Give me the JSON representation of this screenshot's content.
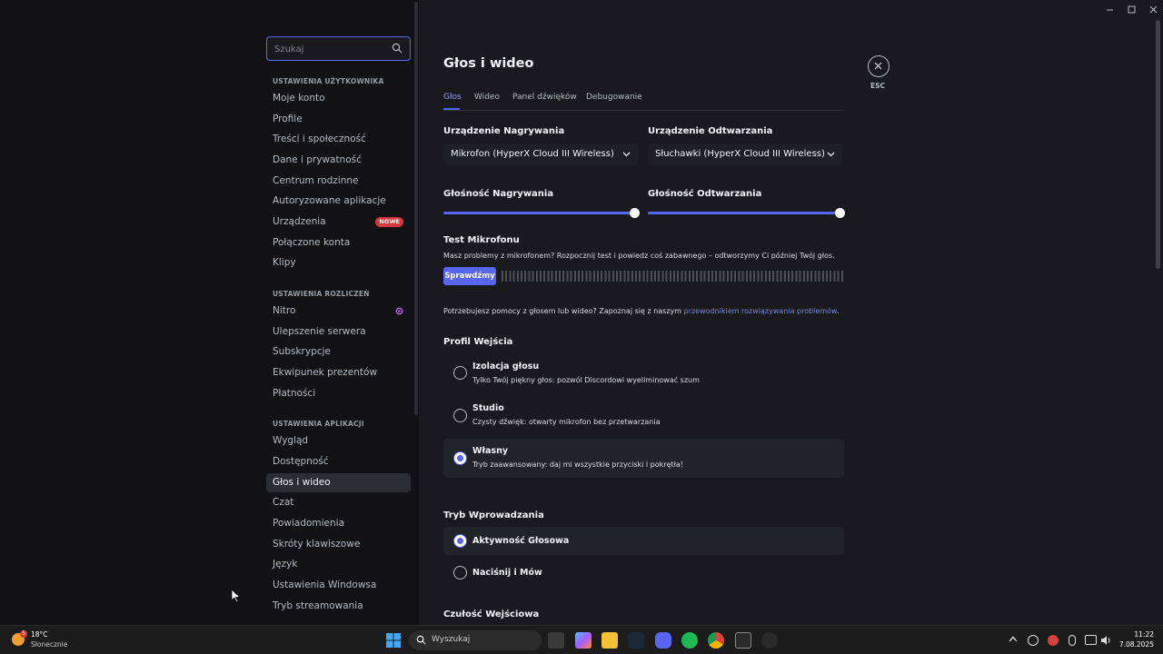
{
  "sidebar": {
    "search_placeholder": "Szukaj",
    "sections": [
      {
        "title": "USTAWIENIA UŻYTKOWNIKA",
        "items": [
          "Moje konto",
          "Profile",
          "Treści i społeczność",
          "Dane i prywatność",
          "Centrum rodzinne",
          "Autoryzowane aplikacje",
          "Urządzenia",
          "Połączone konta",
          "Klipy"
        ]
      },
      {
        "title": "USTAWIENIA ROZLICZEŃ",
        "items": [
          "Nitro",
          "Ulepszenie serwera",
          "Subskrypcje",
          "Ekwipunek prezentów",
          "Płatności"
        ]
      },
      {
        "title": "USTAWIENIA APLIKACJI",
        "items": [
          "Wygląd",
          "Dostępność",
          "Głos i wideo",
          "Czat",
          "Powiadomienia",
          "Skróty klawiszowe",
          "Język",
          "Ustawienia Windowsa",
          "Tryb streamowania"
        ]
      }
    ],
    "new_badge": "NOWE",
    "active_item": "Głos i wideo"
  },
  "main": {
    "title": "Głos i wideo",
    "tabs": [
      "Głos",
      "Wideo",
      "Panel dźwięków",
      "Debugowanie"
    ],
    "close_label": "ESC",
    "input_device_label": "Urządzenie Nagrywania",
    "input_device_value": "Mikrofon (HyperX Cloud III Wireless)",
    "output_device_label": "Urządzenie Odtwarzania",
    "output_device_value": "Słuchawki (HyperX Cloud III Wireless)",
    "input_volume_label": "Głośność Nagrywania",
    "input_volume": 1.0,
    "output_volume_label": "Głośność Odtwarzania",
    "output_volume": 1.0,
    "mic_test_title": "Test Mikrofonu",
    "mic_test_desc": "Masz problemy z mikrofonem? Rozpocznij test i powiedz coś zabawnego – odtworzymy Ci później Twój głos.",
    "mic_test_button": "Sprawdźmy",
    "help_text": "Potrzebujesz pomocy z głosem lub wideo? Zapoznaj się z naszym ",
    "help_link": "przewodnikiem rozwiązywania problemów",
    "help_end": ".",
    "input_profile_title": "Profil Wejścia",
    "profiles": [
      {
        "title": "Izolacja głosu",
        "desc": "Tylko Twój piękny głos: pozwól Discordowi wyeliminować szum"
      },
      {
        "title": "Studio",
        "desc": "Czysty dźwięk: otwarty mikrofon bez przetwarzania"
      },
      {
        "title": "Własny",
        "desc": "Tryb zaawansowany: daj mi wszystkie przyciski i pokrętła!"
      }
    ],
    "input_mode_title": "Tryb Wprowadzania",
    "input_modes": [
      "Aktywność Głosowa",
      "Naciśnij i Mów"
    ],
    "sensitivity_title": "Czułość Wejściowa"
  },
  "taskbar": {
    "temperature": "18°C",
    "condition": "Słonecznie",
    "weather_badge": "5",
    "search_label": "Wyszukaj",
    "time": "11:22",
    "date": "7.08.2025"
  },
  "colors": {
    "accent": "#5865f2",
    "background": "#1a1a1e",
    "sidebar": "#121214"
  }
}
